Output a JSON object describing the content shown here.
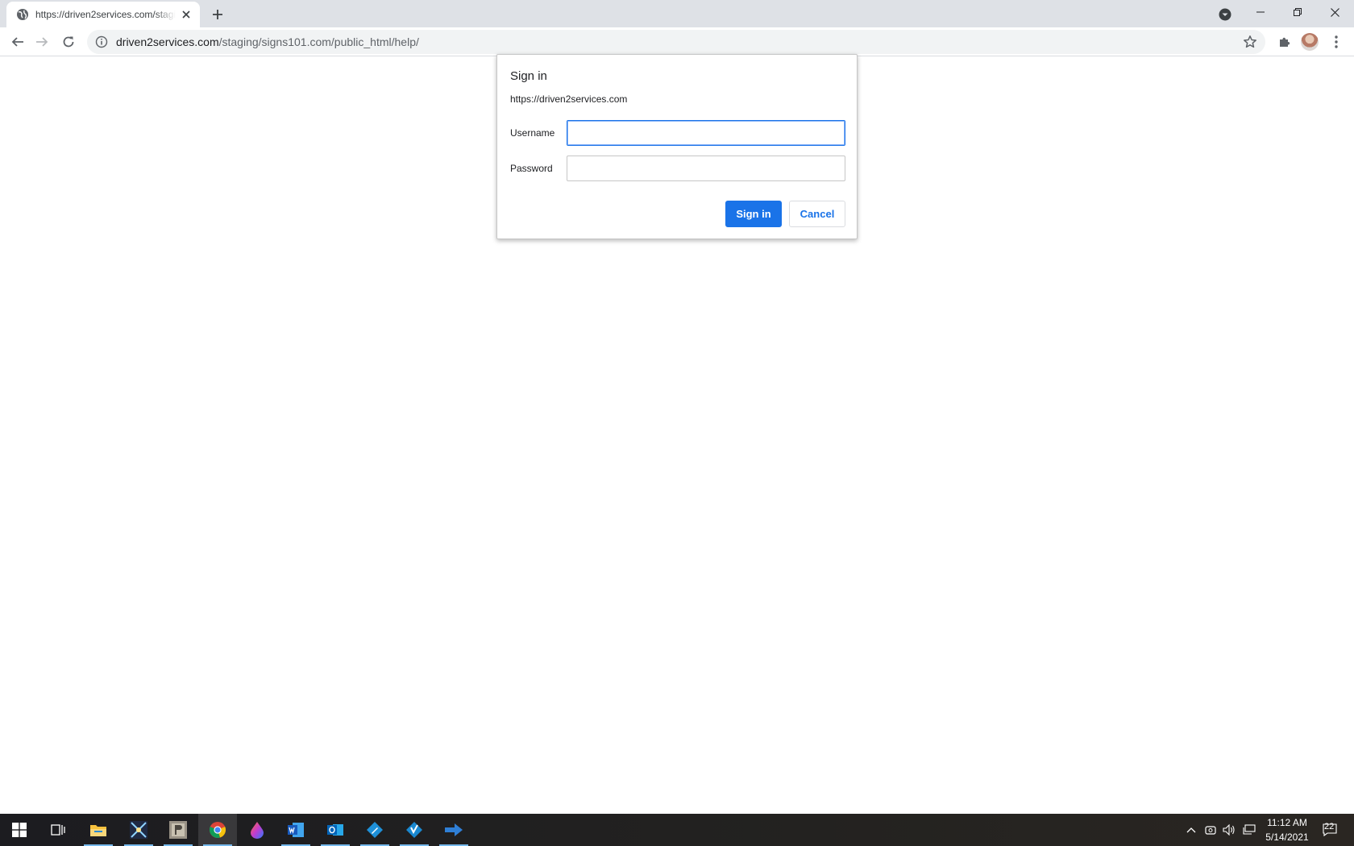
{
  "browser": {
    "tab": {
      "title": "https://driven2services.com/staging/signs101.com/public_html/help/",
      "favicon": "globe-icon"
    },
    "address_bar": {
      "host": "driven2services.com",
      "path": "/staging/signs101.com/public_html/help/"
    }
  },
  "dialog": {
    "title": "Sign in",
    "origin": "https://driven2services.com",
    "username_label": "Username",
    "username_value": "",
    "password_label": "Password",
    "password_value": "",
    "sign_in_label": "Sign in",
    "cancel_label": "Cancel"
  },
  "taskbar": {
    "apps": [
      "start",
      "task-view",
      "file-explorer",
      "app-xformat",
      "app-photo",
      "chrome",
      "app-color-drop",
      "word",
      "outlook",
      "app-blue-diamond",
      "app-blue-diamond-check",
      "app-arrow"
    ],
    "active_app": "chrome",
    "clock": {
      "time": "11:12 AM",
      "date": "5/14/2021"
    },
    "notification_count": "22"
  },
  "colors": {
    "accent": "#1a73e8",
    "tabstrip": "#dee1e6",
    "taskbar": "#1e1e1e"
  }
}
